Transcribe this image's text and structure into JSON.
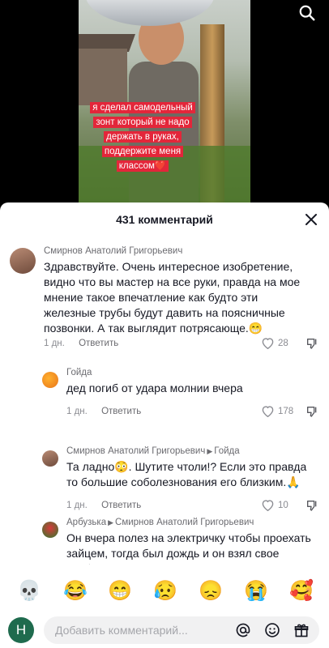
{
  "video": {
    "caption": "я сделал самодельный зонт который не надо держать в руках, поддержите меня классом❤️"
  },
  "sheet": {
    "title": "431 комментарий"
  },
  "comments": [
    {
      "author": "Смирнов Анатолий Григорьевич",
      "reply_to": "",
      "text": "Здравствуйте. Очень интересное изобретение, видно что вы мастер на все руки, правда на мое мнение такое впечатление как будто эти железные трубы будут давить на поясничные позвонки. А так выглядит потрясающе.😁",
      "age": "1 дн.",
      "reply_label": "Ответить",
      "likes": "28"
    },
    {
      "author": "Гойда",
      "reply_to": "",
      "text": "дед погиб от удара молнии вчера",
      "age": "1 дн.",
      "reply_label": "Ответить",
      "likes": "178"
    },
    {
      "author": "Смирнов Анатолий Григорьевич",
      "reply_to": "Гойда",
      "text": "Та ладно😳. Шутите чтоли!? Если это правда то большие соболезнования его близким.🙏",
      "age": "1 дн.",
      "reply_label": "Ответить",
      "likes": "10"
    },
    {
      "author": "Арбузька",
      "reply_to": "Смирнов Анатолий Григорьевич",
      "text": "Он вчера полез на электричку чтобы проехать зайцем, тогда был дождь и он взял свое изобретение. Его ударило током и он",
      "age": "",
      "reply_label": "",
      "likes": ""
    }
  ],
  "emojis": [
    "💀",
    "😂",
    "😁",
    "😥",
    "😞",
    "😭",
    "🥰"
  ],
  "input": {
    "avatar_letter": "Н",
    "placeholder": "Добавить комментарий..."
  },
  "colors": {
    "caption_bg": "#e3263a",
    "avatar_green": "#1f6b4e"
  }
}
